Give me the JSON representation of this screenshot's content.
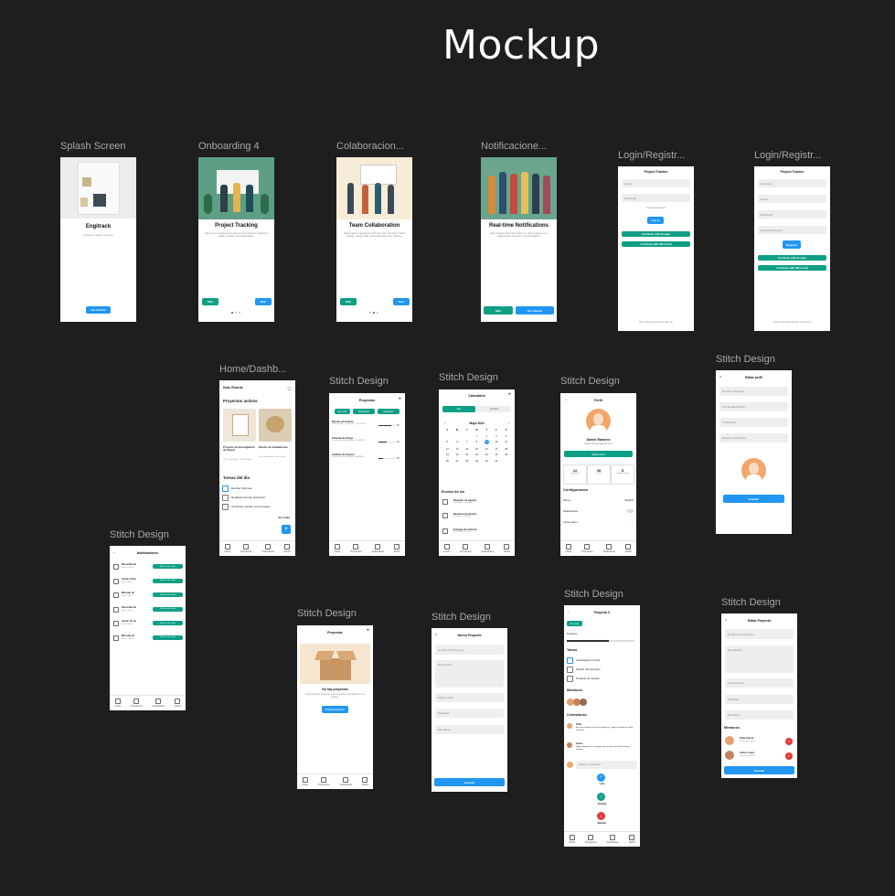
{
  "page_title": "Mockup",
  "colors": {
    "canvas": "#1e1e1e",
    "primary": "#2196f3",
    "teal": "#0e9f85",
    "frame": "#ffffff"
  },
  "frames": {
    "splash": {
      "label": "Splash Screen",
      "heading": "Engitrack",
      "subtitle": "Organize, monitor, and grow.",
      "button": "Get Started"
    },
    "onboarding": {
      "label": "Onboarding 4",
      "heading": "Project Tracking",
      "subtitle": "Stay on top of engineering projects with real-time tracking of tasks, progress, and deliverables.",
      "skip": "Skip",
      "next": "Next"
    },
    "collab": {
      "label": "Colaboracion...",
      "heading": "Team Collaboration",
      "subtitle": "Work together seamlessly with your team members. Share updates, assign tasks, and track progress in real time.",
      "skip": "Skip",
      "next": "Next"
    },
    "notif": {
      "label": "Notificacione...",
      "heading": "Real-time Notifications",
      "subtitle": "Stay updated with instant alerts on task progress, new assignments, and team communications.",
      "skip": "Skip",
      "start": "Get Started"
    },
    "login": {
      "label": "Login/Registr...",
      "header": "Project Tracker",
      "email": "Email",
      "password": "Password",
      "forgot": "Forgot password?",
      "login": "Log In",
      "google": "Continue with Google",
      "microsoft": "Continue with Microsoft",
      "footer": "Don't have an account? Sign up"
    },
    "register": {
      "label": "Login/Registr...",
      "header": "Project Tracker",
      "fullname": "Full name",
      "email": "Email",
      "password": "Password",
      "repeat": "Repeat Password",
      "register": "Register",
      "google": "Continue with Google",
      "microsoft": "Continue with Microsoft",
      "footer": "Login if you already have an account"
    },
    "home": {
      "label": "Home/Dashb...",
      "greeting": "Hola, Ricardo",
      "active_title": "Proyectos activos",
      "p1": "Proyecto de Investigación de Suelos",
      "p1_meta": "75% Completado · Fecha límite",
      "p2": "Diseño de Instalaciones",
      "p2_meta": "50% completado · fecha límite",
      "tasks_title": "Tareas del día",
      "t1": "Revisar Informes",
      "t2": "Redactar informe preliminar",
      "t3": "Coordinar reunión con el equipo",
      "see_all": "Ver todas",
      "nav": [
        "Inicio",
        "Proyectos",
        "Calendario",
        "Perfil"
      ]
    },
    "projects": {
      "label": "Stitch Design",
      "title": "Proyectos",
      "tabs": [
        "En curso",
        "Finalizados",
        "Pausados"
      ],
      "items": [
        {
          "name": "Diseño de Puente",
          "meta": "Ponceria: Arq. | Por Diseñar · 12/12/2024",
          "pct": "75"
        },
        {
          "name": "Sistema de Riego",
          "meta": "Proceso: delta | Implantado · 10/09/2024",
          "pct": "50"
        },
        {
          "name": "Análisis de Suelos",
          "meta": "Proceso: Suelo Tecla Arqu · 09/06/2024",
          "pct": "25"
        }
      ],
      "nav": [
        "Inicio",
        "Proyectos",
        "Calendario",
        "Perfil"
      ]
    },
    "calendar": {
      "label": "Stitch Design",
      "title": "Calendario",
      "tabs": [
        "Mes",
        "Semana"
      ],
      "month": "Mayo 2024",
      "weekdays": [
        "S",
        "M",
        "T",
        "W",
        "T",
        "F",
        "S"
      ],
      "days": [
        "",
        "",
        "",
        "1",
        "2",
        "3",
        "4",
        "5",
        "6",
        "7",
        "8",
        "9",
        "10",
        "11",
        "12",
        "13",
        "14",
        "15",
        "16",
        "17",
        "18",
        "19",
        "20",
        "21",
        "22",
        "23",
        "24",
        "25",
        "26",
        "27",
        "28",
        "29",
        "30",
        "31"
      ],
      "selected": "9",
      "events_title": "Eventos del día",
      "events": [
        {
          "name": "Reunión de equipo",
          "time": "10:00 AM - 11:00 AM"
        },
        {
          "name": "Revisión de diseño",
          "time": "1:00 PM - 2:00 PM"
        },
        {
          "name": "Entrega de informe",
          "time": "3:00 PM - 4:00 PM"
        }
      ],
      "nav": [
        "Inicio",
        "Proyectos",
        "Calendario",
        "Perfil"
      ]
    },
    "profile": {
      "label": "Stitch Design",
      "title": "Perfil",
      "name": "Daniel Ramírez",
      "email": "daniel.ramirez@gmail.com",
      "edit": "Editar perfil",
      "stats": [
        {
          "value": "12",
          "label": "Proyectos"
        },
        {
          "value": "45",
          "label": "Tareas"
        },
        {
          "value": "8",
          "label": "Colaboraciones"
        }
      ],
      "config_title": "Configuración",
      "lang": "Idioma",
      "lang_val": "Español",
      "notifs": "Notificaciones",
      "logout": "Cerrar sesión",
      "nav": [
        "Inicio",
        "Proyectos",
        "Calendario",
        "Perfil"
      ]
    },
    "edit_profile": {
      "label": "Stitch Design",
      "title": "Editar perfil",
      "f1": "Nombre Completo",
      "f2": "Correo Electrónico",
      "f3": "Contraseña",
      "f4": "Repetir Contraseña",
      "save": "Guardar"
    },
    "notifications": {
      "label": "Stitch Design",
      "title": "Notificaciones",
      "items": [
        {
          "name": "Recordatorio",
          "time": "Faltan 2 horas"
        },
        {
          "name": "Alerta: Tarea",
          "time": "tarea a 8:00"
        },
        {
          "name": "Mensaje de",
          "time": "Hace 3 horas"
        },
        {
          "name": "Recordatorio",
          "time": "Hace 8 horas"
        },
        {
          "name": "Alerta: Se ha",
          "time": "Hace 10 horas"
        },
        {
          "name": "Mensaje de",
          "time": "Hace 12 horas"
        }
      ],
      "action": "Marcar como leído",
      "nav": [
        "Inicio",
        "Proyectos",
        "Calendario",
        "Perfil"
      ]
    },
    "empty_projects": {
      "label": "Stitch Design",
      "title": "Proyectos",
      "empty_title": "No hay proyectos",
      "empty_sub": "Crea tu primer proyecto para empezar a gestionar con tu equipo.",
      "create": "Crear proyecto",
      "nav": [
        "Inicio",
        "Proyectos",
        "Calendario",
        "Perfil"
      ]
    },
    "new_project": {
      "label": "Stitch Design",
      "title": "Nuevo Proyecto",
      "f1": "Nombre del Proyecto",
      "f2": "Descripción",
      "f3": "Fecha Límite",
      "f4": "Prioridad",
      "f5": "Miembros",
      "save": "Guardar"
    },
    "project_detail": {
      "label": "Stitch Design",
      "title": "Proyecto X",
      "status": "En curso",
      "progress": "Progreso",
      "progress_value": 0.62,
      "tasks_title": "Tareas",
      "t1": "Investigación Inicial",
      "t2": "Diseño del prototipo",
      "t3": "Pruebas de usuario",
      "members": "Miembros",
      "comments": "Comentarios",
      "c1_name": "Sofía",
      "c1_text": "Me está gustando como va la integración, ¿alguna actualización sobre el diseño?",
      "c2_name": "Carlos",
      "c2_text": "Estoy trabajando en el prototipo. Espero tener una demo lista para mañana.",
      "comment_ph": "Escribe un comentario...",
      "a1": "Listo",
      "a2": "Archivar",
      "a3": "Eliminar",
      "nav": [
        "Inicio",
        "Proyectos",
        "Calendario",
        "Perfil"
      ]
    },
    "edit_project": {
      "label": "Stitch Design",
      "title": "Editar Proyecto",
      "f1": "Nombre del Proyecto",
      "f2": "Descripción",
      "f3": "Fecha Límite",
      "f4": "Prioridad",
      "f5": "Miembros",
      "members": "Miembros",
      "m1": "Sofía García",
      "m1_role": "Diseño de producto",
      "m2": "Carlos López",
      "m2_role": "Diseño de producto",
      "save": "Guardar"
    }
  }
}
